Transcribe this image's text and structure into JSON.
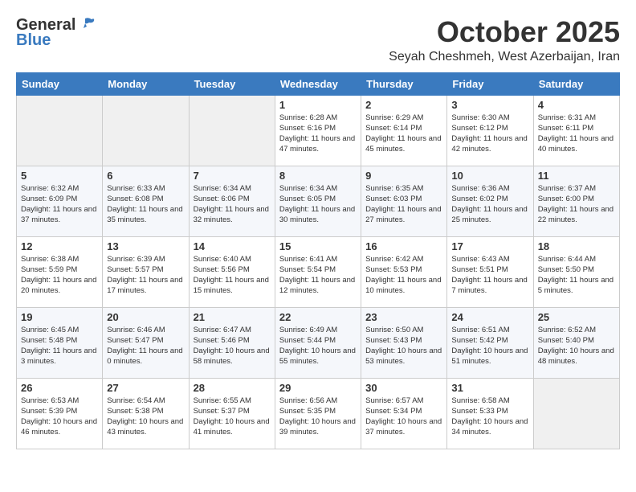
{
  "header": {
    "logo_general": "General",
    "logo_blue": "Blue",
    "month": "October 2025",
    "location": "Seyah Cheshmeh, West Azerbaijan, Iran"
  },
  "weekdays": [
    "Sunday",
    "Monday",
    "Tuesday",
    "Wednesday",
    "Thursday",
    "Friday",
    "Saturday"
  ],
  "weeks": [
    [
      {
        "day": "",
        "empty": true
      },
      {
        "day": "",
        "empty": true
      },
      {
        "day": "",
        "empty": true
      },
      {
        "day": "1",
        "sunrise": "6:28 AM",
        "sunset": "6:16 PM",
        "daylight": "11 hours and 47 minutes."
      },
      {
        "day": "2",
        "sunrise": "6:29 AM",
        "sunset": "6:14 PM",
        "daylight": "11 hours and 45 minutes."
      },
      {
        "day": "3",
        "sunrise": "6:30 AM",
        "sunset": "6:12 PM",
        "daylight": "11 hours and 42 minutes."
      },
      {
        "day": "4",
        "sunrise": "6:31 AM",
        "sunset": "6:11 PM",
        "daylight": "11 hours and 40 minutes."
      }
    ],
    [
      {
        "day": "5",
        "sunrise": "6:32 AM",
        "sunset": "6:09 PM",
        "daylight": "11 hours and 37 minutes."
      },
      {
        "day": "6",
        "sunrise": "6:33 AM",
        "sunset": "6:08 PM",
        "daylight": "11 hours and 35 minutes."
      },
      {
        "day": "7",
        "sunrise": "6:34 AM",
        "sunset": "6:06 PM",
        "daylight": "11 hours and 32 minutes."
      },
      {
        "day": "8",
        "sunrise": "6:34 AM",
        "sunset": "6:05 PM",
        "daylight": "11 hours and 30 minutes."
      },
      {
        "day": "9",
        "sunrise": "6:35 AM",
        "sunset": "6:03 PM",
        "daylight": "11 hours and 27 minutes."
      },
      {
        "day": "10",
        "sunrise": "6:36 AM",
        "sunset": "6:02 PM",
        "daylight": "11 hours and 25 minutes."
      },
      {
        "day": "11",
        "sunrise": "6:37 AM",
        "sunset": "6:00 PM",
        "daylight": "11 hours and 22 minutes."
      }
    ],
    [
      {
        "day": "12",
        "sunrise": "6:38 AM",
        "sunset": "5:59 PM",
        "daylight": "11 hours and 20 minutes."
      },
      {
        "day": "13",
        "sunrise": "6:39 AM",
        "sunset": "5:57 PM",
        "daylight": "11 hours and 17 minutes."
      },
      {
        "day": "14",
        "sunrise": "6:40 AM",
        "sunset": "5:56 PM",
        "daylight": "11 hours and 15 minutes."
      },
      {
        "day": "15",
        "sunrise": "6:41 AM",
        "sunset": "5:54 PM",
        "daylight": "11 hours and 12 minutes."
      },
      {
        "day": "16",
        "sunrise": "6:42 AM",
        "sunset": "5:53 PM",
        "daylight": "11 hours and 10 minutes."
      },
      {
        "day": "17",
        "sunrise": "6:43 AM",
        "sunset": "5:51 PM",
        "daylight": "11 hours and 7 minutes."
      },
      {
        "day": "18",
        "sunrise": "6:44 AM",
        "sunset": "5:50 PM",
        "daylight": "11 hours and 5 minutes."
      }
    ],
    [
      {
        "day": "19",
        "sunrise": "6:45 AM",
        "sunset": "5:48 PM",
        "daylight": "11 hours and 3 minutes."
      },
      {
        "day": "20",
        "sunrise": "6:46 AM",
        "sunset": "5:47 PM",
        "daylight": "11 hours and 0 minutes."
      },
      {
        "day": "21",
        "sunrise": "6:47 AM",
        "sunset": "5:46 PM",
        "daylight": "10 hours and 58 minutes."
      },
      {
        "day": "22",
        "sunrise": "6:49 AM",
        "sunset": "5:44 PM",
        "daylight": "10 hours and 55 minutes."
      },
      {
        "day": "23",
        "sunrise": "6:50 AM",
        "sunset": "5:43 PM",
        "daylight": "10 hours and 53 minutes."
      },
      {
        "day": "24",
        "sunrise": "6:51 AM",
        "sunset": "5:42 PM",
        "daylight": "10 hours and 51 minutes."
      },
      {
        "day": "25",
        "sunrise": "6:52 AM",
        "sunset": "5:40 PM",
        "daylight": "10 hours and 48 minutes."
      }
    ],
    [
      {
        "day": "26",
        "sunrise": "6:53 AM",
        "sunset": "5:39 PM",
        "daylight": "10 hours and 46 minutes."
      },
      {
        "day": "27",
        "sunrise": "6:54 AM",
        "sunset": "5:38 PM",
        "daylight": "10 hours and 43 minutes."
      },
      {
        "day": "28",
        "sunrise": "6:55 AM",
        "sunset": "5:37 PM",
        "daylight": "10 hours and 41 minutes."
      },
      {
        "day": "29",
        "sunrise": "6:56 AM",
        "sunset": "5:35 PM",
        "daylight": "10 hours and 39 minutes."
      },
      {
        "day": "30",
        "sunrise": "6:57 AM",
        "sunset": "5:34 PM",
        "daylight": "10 hours and 37 minutes."
      },
      {
        "day": "31",
        "sunrise": "6:58 AM",
        "sunset": "5:33 PM",
        "daylight": "10 hours and 34 minutes."
      },
      {
        "day": "",
        "empty": true
      }
    ]
  ]
}
